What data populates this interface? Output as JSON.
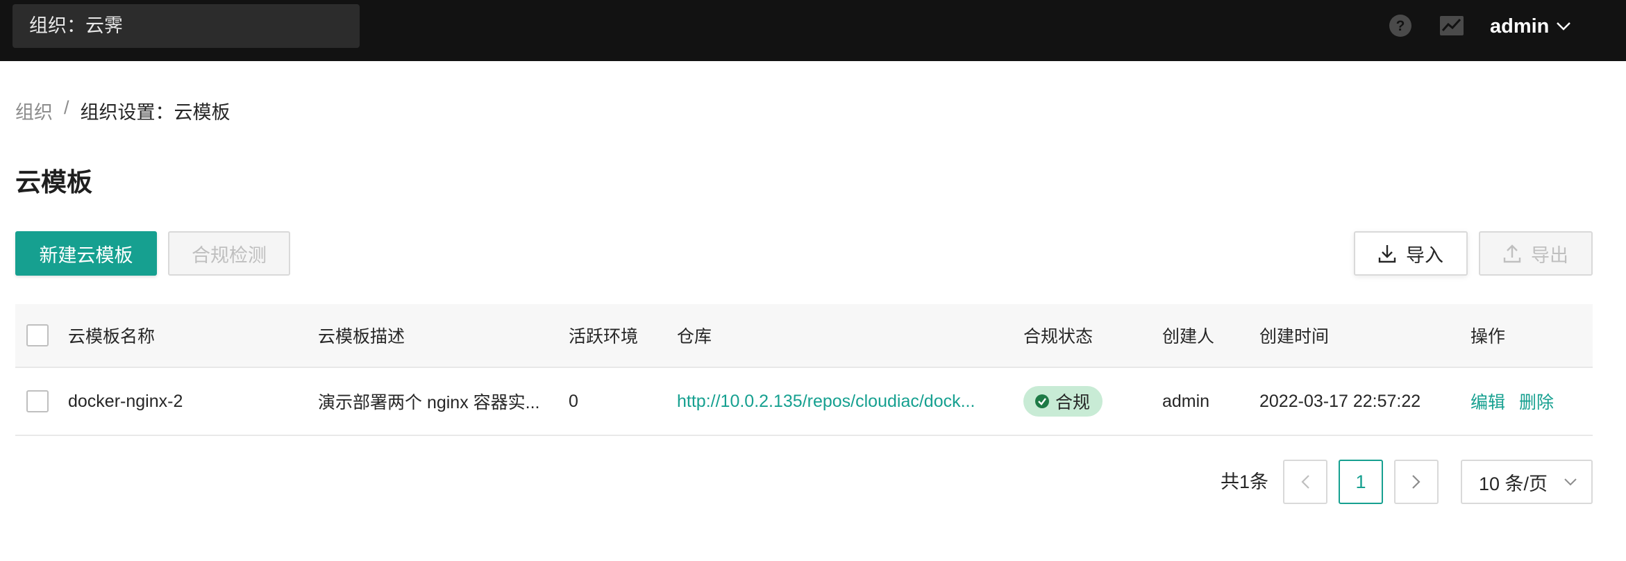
{
  "topbar": {
    "org_selector": "组织：云霁",
    "user_name": "admin"
  },
  "breadcrumb": {
    "root": "组织",
    "separator": "/",
    "current": "组织设置：云模板"
  },
  "page": {
    "title": "云模板"
  },
  "toolbar": {
    "create_label": "新建云模板",
    "compliance_check_label": "合规检测",
    "import_label": "导入",
    "export_label": "导出"
  },
  "table": {
    "headers": {
      "name": "云模板名称",
      "description": "云模板描述",
      "active_envs": "活跃环境",
      "repo": "仓库",
      "compliance": "合规状态",
      "creator": "创建人",
      "created_at": "创建时间",
      "actions": "操作"
    },
    "rows": [
      {
        "name": "docker-nginx-2",
        "description": "演示部署两个 nginx 容器实...",
        "active_envs": "0",
        "repo": "http://10.0.2.135/repos/cloudiac/dock...",
        "compliance": "合规",
        "creator": "admin",
        "created_at": "2022-03-17 22:57:22",
        "edit_label": "编辑",
        "delete_label": "删除"
      }
    ]
  },
  "pagination": {
    "total": "共1条",
    "current_page": "1",
    "page_size": "10 条/页"
  },
  "colors": {
    "primary": "#16a090",
    "topbar_bg": "#121212",
    "badge_bg": "#c8ebd5"
  },
  "icons": [
    "help-icon",
    "monitor-chart-icon",
    "chevron-down-icon",
    "download-icon",
    "upload-icon",
    "check-circle-icon",
    "chevron-left-icon",
    "chevron-right-icon"
  ]
}
